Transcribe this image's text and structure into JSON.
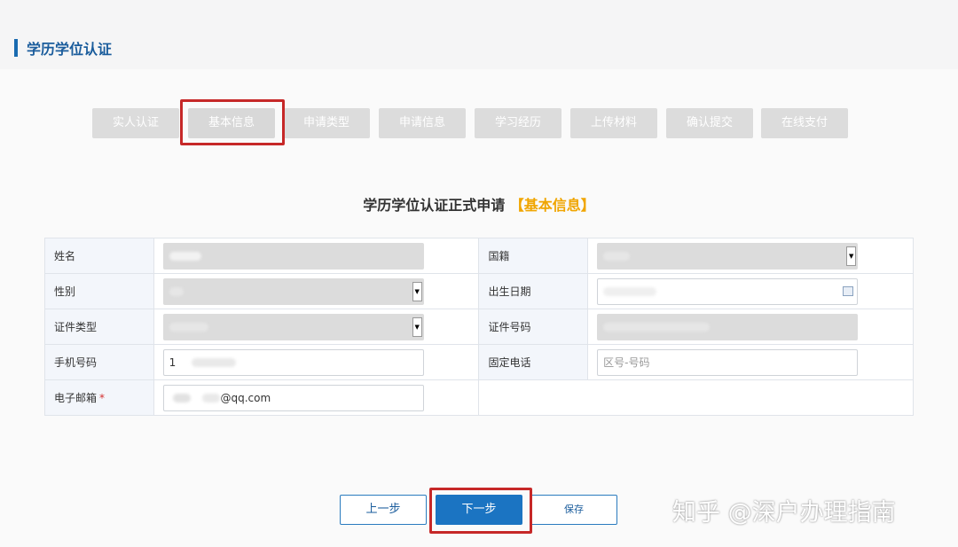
{
  "header": {
    "title": "学历学位认证"
  },
  "steps": [
    "实人认证",
    "基本信息",
    "申请类型",
    "申请信息",
    "学习经历",
    "上传材料",
    "确认提交",
    "在线支付"
  ],
  "form": {
    "title": "学历学位认证正式申请",
    "title_suffix": "【基本信息】",
    "fields": {
      "name_label": "姓名",
      "nationality_label": "国籍",
      "gender_label": "性别",
      "birthdate_label": "出生日期",
      "id_type_label": "证件类型",
      "id_number_label": "证件号码",
      "mobile_label": "手机号码",
      "mobile_value": "1",
      "phone_label": "固定电话",
      "phone_placeholder": "区号-号码",
      "email_label": "电子邮箱",
      "email_required": "*",
      "email_value_suffix": "@qq.com"
    }
  },
  "buttons": {
    "prev": "上一步",
    "next": "下一步",
    "save": "保存"
  },
  "watermark": "知乎 @深户办理指南",
  "colors": {
    "accent": "#1b74c2",
    "highlight": "#c62828",
    "title_accent": "#f0a500"
  }
}
